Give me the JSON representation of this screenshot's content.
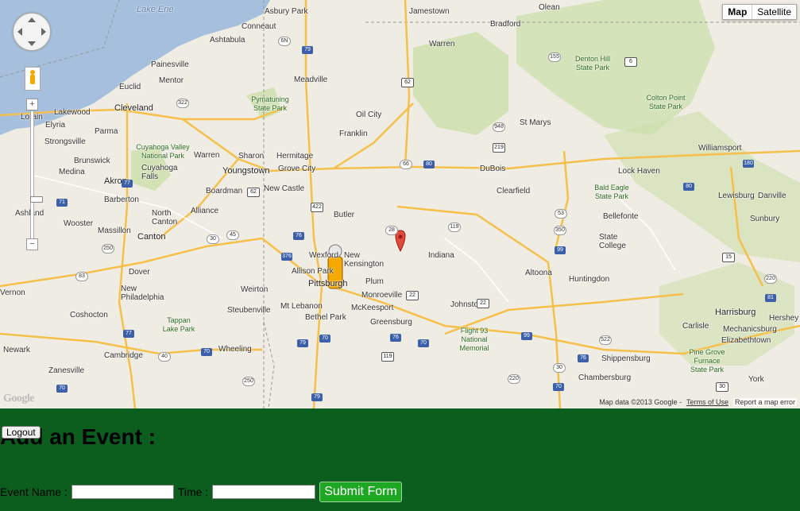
{
  "map": {
    "type_buttons": [
      "Map",
      "Satellite"
    ],
    "zoom_in": "+",
    "zoom_out": "−",
    "attribution": "Map data ©2013 Google -",
    "terms": "Terms of Use",
    "report": "Report a map error",
    "logo": "Google",
    "water_labels": [
      "Lake Erie"
    ],
    "cities": [
      "Asbury Park",
      "Jamestown",
      "Olean",
      "Bradford",
      "Conneaut",
      "Ashtabula",
      "Warren",
      "Painesville",
      "Mentor",
      "Denton Hill State Park",
      "Euclid",
      "Meadville",
      "Cleveland",
      "Lakewood",
      "Lorain",
      "Elyria",
      "Parma",
      "Pymatuning State Park",
      "Oil City",
      "St Marys",
      "Colton Point State Park",
      "Strongsville",
      "Franklin",
      "Cuyahoga Valley National Park",
      "Brunswick",
      "Warren",
      "Sharon",
      "Hermitage",
      "Williamsport",
      "Medina",
      "Cuyahoga Falls",
      "Youngstown",
      "Grove City",
      "DuBois",
      "Lock Haven",
      "Akron",
      "Boardman",
      "New Castle",
      "Clearfield",
      "Bald Eagle State Park",
      "Lewisburg",
      "Danville",
      "Barberton",
      "Ashland",
      "North Canton",
      "Alliance",
      "Butler",
      "Bellefonte",
      "Sunbury",
      "Wooster",
      "Massillon",
      "Canton",
      "State College",
      "Indiana",
      "Wexford",
      "New Kensington",
      "Altoona",
      "Allison Park",
      "Pittsburgh",
      "Plum",
      "Dover",
      "Huntingdon",
      "Vernon",
      "New Philadelphia",
      "Weirton",
      "Monroeville",
      "Harrisburg",
      "Hershey",
      "Mt Lebanon",
      "McKeesport",
      "Johnstown",
      "Coshocton",
      "Steubenville",
      "Bethel Park",
      "Greensburg",
      "Tappan Lake Park",
      "Carlisle",
      "Mechanicsburg",
      "Elizabethtown",
      "Flight 93 National Memorial",
      "Newark",
      "Cambridge",
      "Wheeling",
      "Pine Grove Furnace State Park",
      "Shippensburg",
      "Zanesville",
      "Chambersburg",
      "York"
    ],
    "shields": [
      "6N",
      "79",
      "322",
      "62",
      "155",
      "6",
      "948",
      "219",
      "80",
      "66",
      "180",
      "71",
      "77",
      "62",
      "422",
      "80",
      "53",
      "15",
      "250",
      "76",
      "30",
      "45",
      "28",
      "119",
      "350",
      "99",
      "376",
      "83",
      "22",
      "22",
      "81",
      "220",
      "77",
      "76",
      "70",
      "79",
      "70",
      "119",
      "70",
      "99",
      "522",
      "76",
      "250",
      "40",
      "30",
      "70",
      "30",
      "220",
      "70",
      "79"
    ]
  },
  "form": {
    "logout_label": "Logout",
    "heading": "Add an Event :",
    "event_name_label": "Event Name :",
    "time_label": "Time :",
    "event_name_value": "",
    "time_value": "",
    "submit_label": "Submit Form"
  },
  "colors": {
    "panel_bg": "#0b5e1d",
    "submit_bg": "#1ea723",
    "water": "#a5bfdd",
    "park": "#cbe0a9",
    "road": "#f5c04a"
  }
}
